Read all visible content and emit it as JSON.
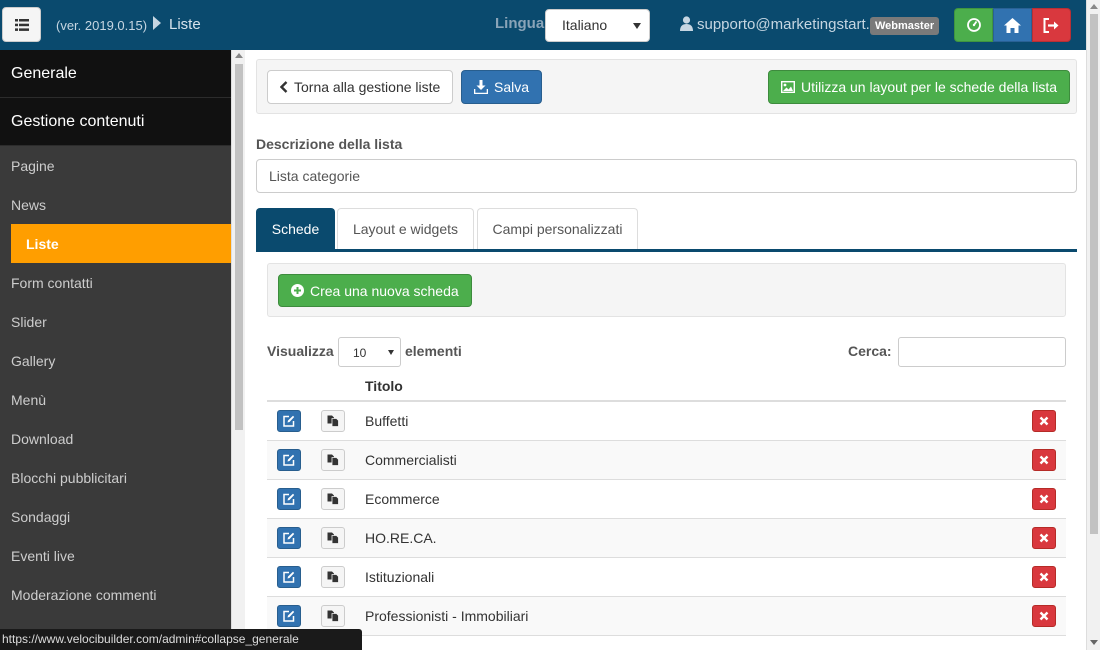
{
  "header": {
    "version": "(ver. 2019.0.15)",
    "breadcrumb_current": "Liste",
    "language_label": "Lingua",
    "language_selected": "Italiano",
    "user_email": "supporto@marketingstart.it",
    "role_badge": "Webmaster"
  },
  "sidebar": {
    "sections": [
      {
        "label": "Generale"
      },
      {
        "label": "Gestione contenuti"
      }
    ],
    "items": [
      {
        "label": "Pagine"
      },
      {
        "label": "News"
      },
      {
        "label": "Liste",
        "active": true
      },
      {
        "label": "Form contatti"
      },
      {
        "label": "Slider"
      },
      {
        "label": "Gallery"
      },
      {
        "label": "Menù"
      },
      {
        "label": "Download"
      },
      {
        "label": "Blocchi pubblicitari"
      },
      {
        "label": "Sondaggi"
      },
      {
        "label": "Eventi live"
      },
      {
        "label": "Moderazione commenti"
      }
    ]
  },
  "toolbar": {
    "back_label": "Torna alla gestione liste",
    "save_label": "Salva",
    "layout_label": "Utilizza un layout per le schede della lista"
  },
  "form": {
    "description_label": "Descrizione della lista",
    "description_value": "Lista categorie"
  },
  "tabs": [
    {
      "label": "Schede",
      "active": true
    },
    {
      "label": "Layout e widgets"
    },
    {
      "label": "Campi personalizzati"
    }
  ],
  "cards": {
    "create_label": "Crea una nuova scheda",
    "show_label": "Visualizza",
    "show_value": "10",
    "elements_label": "elementi",
    "search_label": "Cerca:",
    "search_value": "",
    "column_title": "Titolo",
    "rows": [
      {
        "title": "Buffetti"
      },
      {
        "title": "Commercialisti"
      },
      {
        "title": "Ecommerce"
      },
      {
        "title": "HO.RE.CA."
      },
      {
        "title": "Istituzionali"
      },
      {
        "title": "Professionisti - Immobiliari"
      }
    ]
  },
  "status_bar": {
    "url": "https://www.velocibuilder.com/admin#collapse_generale"
  },
  "colors": {
    "header_bg": "#0a4a6e",
    "sidebar_bg": "#3a3a3a",
    "active_item": "#ff9e00",
    "primary": "#3172b0",
    "success": "#4cae4c",
    "danger": "#d9383e"
  }
}
